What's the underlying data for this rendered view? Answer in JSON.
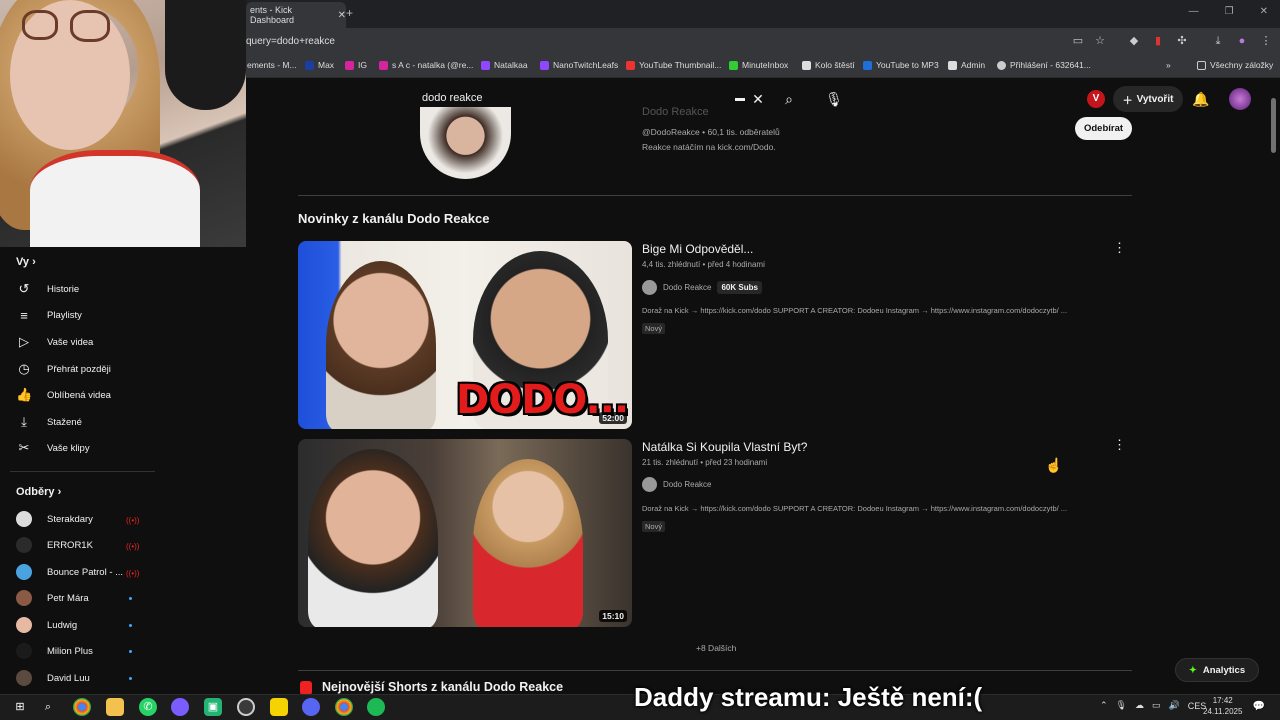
{
  "browser": {
    "tab_title": "ents - Kick Dashboard",
    "tab_close": "✕",
    "new_tab": "+",
    "url": "query=dodo+reakce",
    "bookmarks": [
      "ements - M...",
      "Max",
      "IG",
      "s A c - natalka (@re...",
      "Natalkaa",
      "NanoTwitchLeafs",
      "YouTube Thumbnail...",
      "MinuteInbox",
      "Kolo štěstí",
      "YouTube to MP3",
      "Admin",
      "Přihlášení - 632641...",
      "Všechny záložky"
    ]
  },
  "youtube": {
    "search_query": "dodo reakce",
    "create_label": "Vytvořit",
    "channel": {
      "name_faded": "Dodo Reakce",
      "handle_meta": "@DodoReakce • 60,1 tis. odběratelů",
      "description": "Reakce natáčím na kick.com/Dodo.",
      "subscribe_label": "Odebírat"
    },
    "section_title": "Novinky z kanálu Dodo Reakce",
    "videos": [
      {
        "title": "Bige Mi Odpověděl...",
        "meta": "4,4 tis. zhlédnutí • před 4 hodinami",
        "channel": "Dodo Reakce",
        "badge": "60K Subs",
        "description": "Doraž na Kick → https://kick.com/dodo SUPPORT A CREATOR: Dodoeu Instagram → https://www.instagram.com/dodoczytb/ ...",
        "new_label": "Nový",
        "duration": "52:00",
        "thumb_text": "DODO..."
      },
      {
        "title": "Natálka Si Koupila Vlastní Byt?",
        "meta": "21 tis. zhlédnutí • před 23 hodinami",
        "channel": "Dodo Reakce",
        "description": "Doraž na Kick → https://kick.com/dodo SUPPORT A CREATOR: Dodoeu Instagram → https://www.instagram.com/dodoczytb/ ...",
        "new_label": "Nový",
        "duration": "15:10"
      }
    ],
    "more_label": "+8 Dalších",
    "shorts_title": "Nejnovější Shorts z kanálu Dodo Reakce",
    "analytics_label": "Analytics"
  },
  "sidebar": {
    "you_heading": "Vy",
    "items": [
      {
        "label": "Historie",
        "icon": "history-icon"
      },
      {
        "label": "Playlisty",
        "icon": "playlist-icon"
      },
      {
        "label": "Vaše videa",
        "icon": "your-videos-icon"
      },
      {
        "label": "Přehrát později",
        "icon": "watch-later-icon"
      },
      {
        "label": "Oblíbená videa",
        "icon": "liked-icon"
      },
      {
        "label": "Stažené",
        "icon": "download-icon"
      },
      {
        "label": "Vaše klipy",
        "icon": "clips-icon"
      }
    ],
    "subs_heading": "Odběry",
    "subscriptions": [
      {
        "name": "Sterakdary",
        "status": "live",
        "color": "#dcdcdc"
      },
      {
        "name": "ERROR1K",
        "status": "live",
        "color": "#2b2b2b"
      },
      {
        "name": "Bounce Patrol - ...",
        "status": "live",
        "color": "#4aa3df"
      },
      {
        "name": "Petr Mára",
        "status": "new",
        "color": "#8a5a44"
      },
      {
        "name": "Ludwig",
        "status": "new",
        "color": "#e6b9a3"
      },
      {
        "name": "Milion Plus",
        "status": "new",
        "color": "#1b1b1b"
      },
      {
        "name": "David Luu",
        "status": "new",
        "color": "#5a4a3f"
      }
    ]
  },
  "stream_overlay": {
    "text": "Daddy streamu: Ještě není:("
  },
  "taskbar": {
    "language": "CES",
    "time": "17:42",
    "date": "24.11.2025"
  },
  "colors": {
    "background": "#0f0f0f",
    "accent_red": "#c4151c",
    "live_red": "#e22222",
    "new_dot": "#3ea6ff"
  }
}
